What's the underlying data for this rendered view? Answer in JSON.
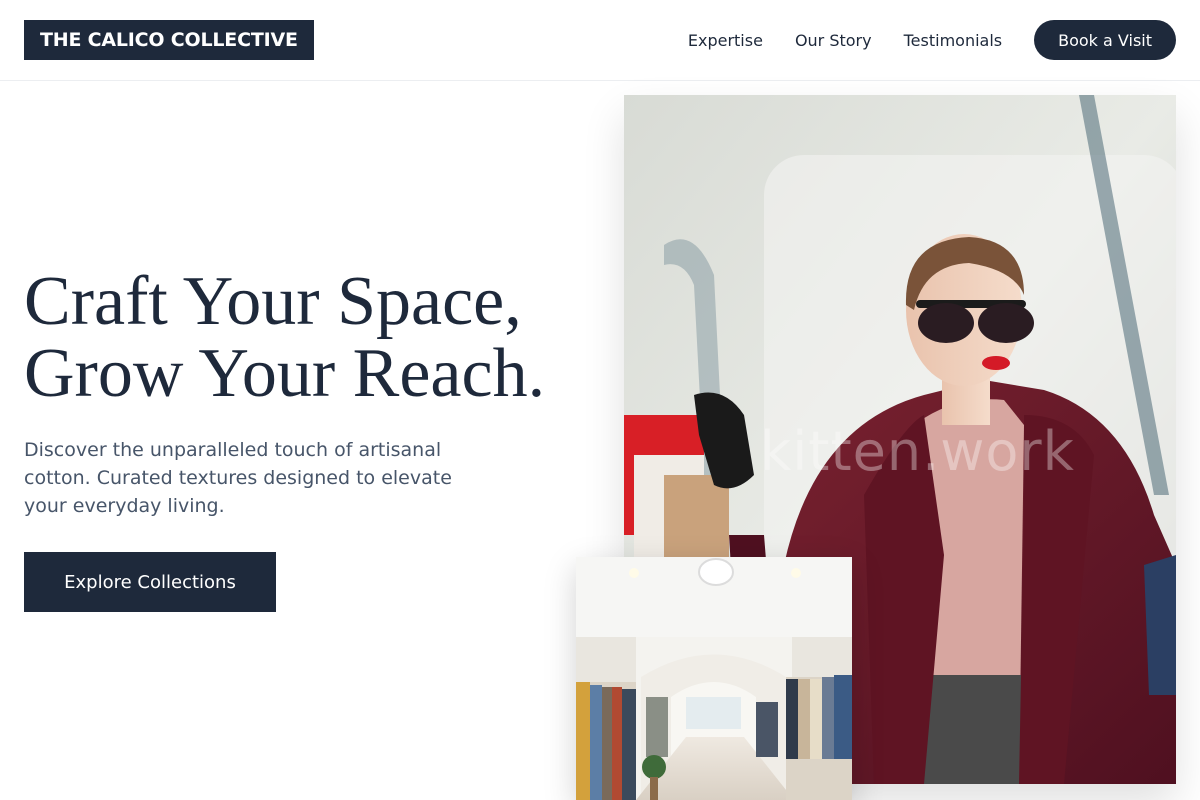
{
  "header": {
    "logo": "THE CALICO COLLECTIVE",
    "nav": [
      {
        "label": "Expertise"
      },
      {
        "label": "Our Story"
      },
      {
        "label": "Testimonials"
      }
    ],
    "cta_label": "Book a Visit"
  },
  "hero": {
    "title_line1": "Craft Your Space,",
    "title_line2": "Grow Your Reach.",
    "description": "Discover the unparalleled touch of artisanal cotton. Curated textures designed to elevate your everyday living.",
    "cta_label": "Explore Collections"
  },
  "images": {
    "main_photo": "woman-in-burgundy-coat-photo",
    "main_watermark": "kitten.work",
    "store_photo": "clothing-store-interior-photo"
  },
  "colors": {
    "brand_dark": "#1e293b",
    "text_muted": "#475569",
    "coat": "#6e1b2a"
  }
}
